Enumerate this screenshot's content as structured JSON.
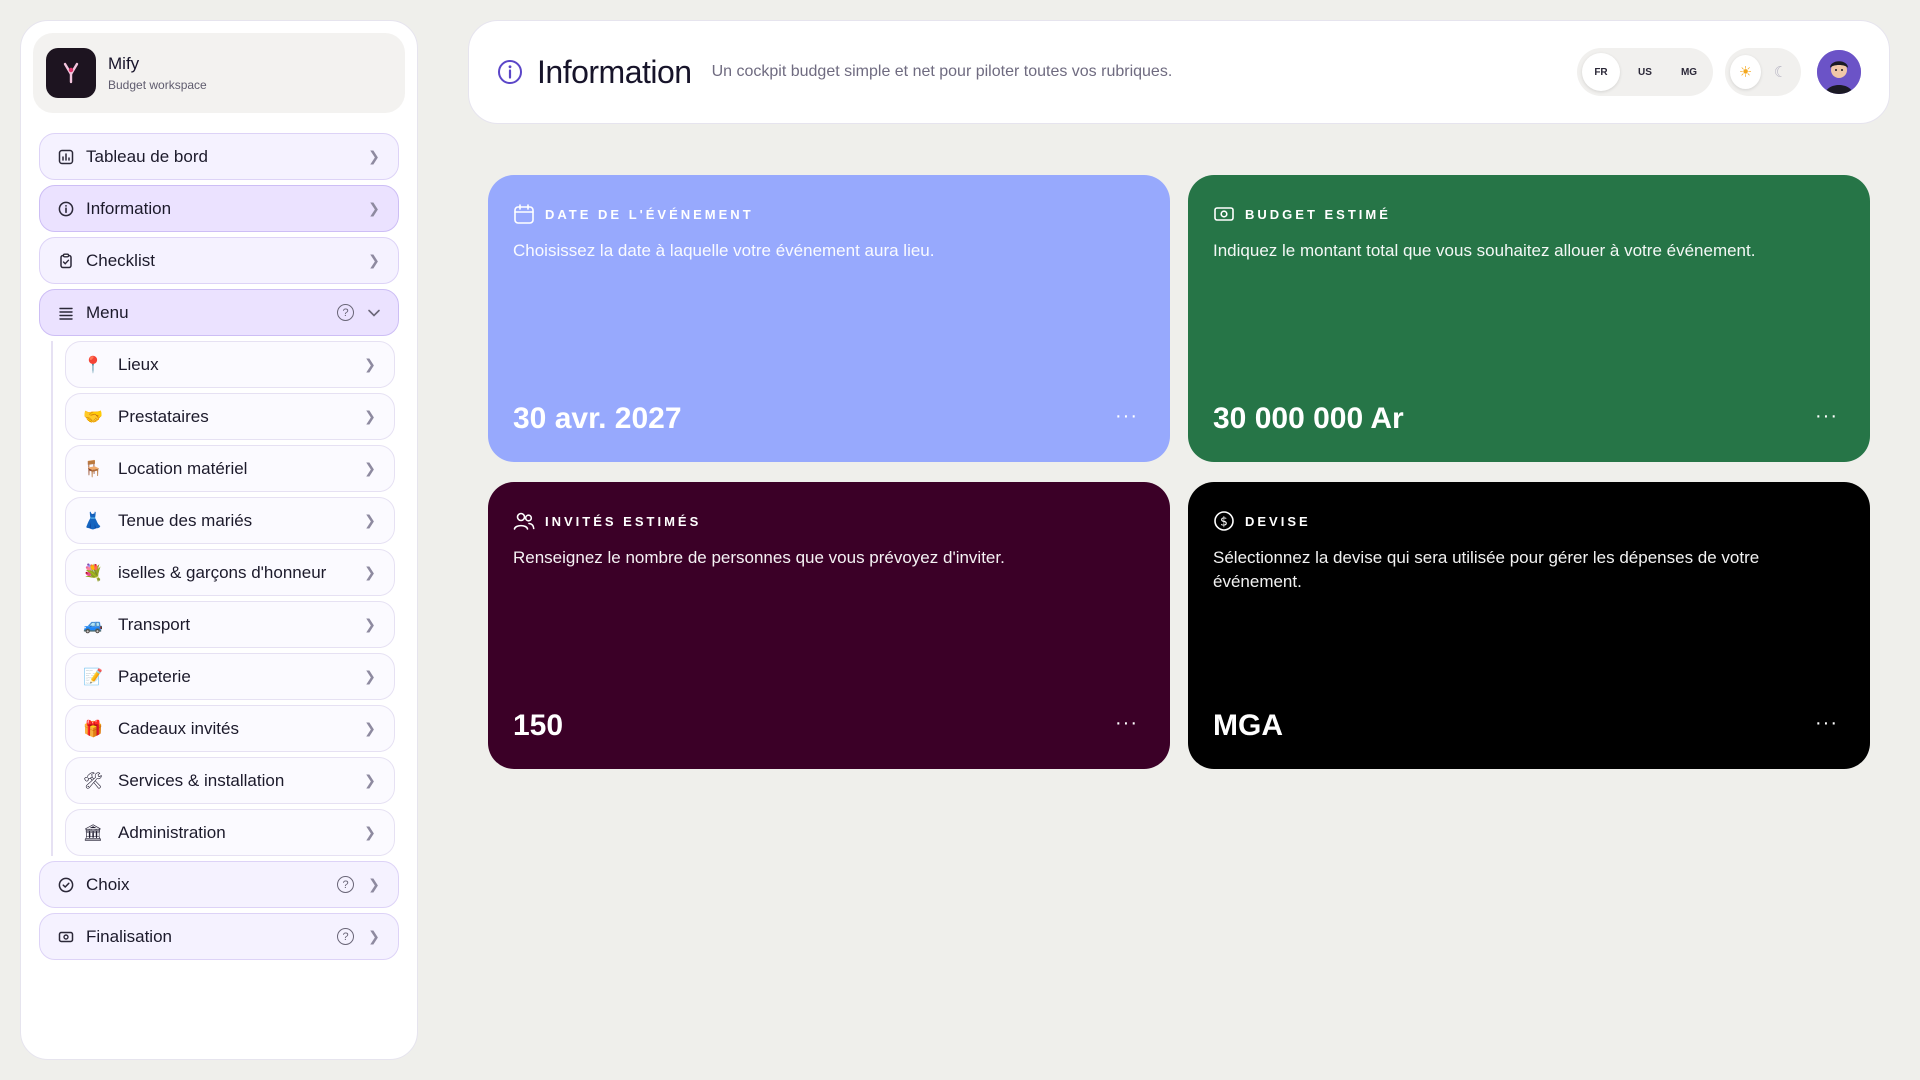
{
  "brand": {
    "name": "Mify",
    "subtitle": "Budget workspace"
  },
  "sidebar": {
    "items": [
      {
        "label": "Tableau de bord",
        "icon": "chart-icon"
      },
      {
        "label": "Information",
        "icon": "info-icon",
        "active": true
      },
      {
        "label": "Checklist",
        "icon": "clipboard-icon"
      },
      {
        "label": "Menu",
        "icon": "menu-icon",
        "expanded": true
      },
      {
        "label": "Choix",
        "icon": "check-circle-icon"
      },
      {
        "label": "Finalisation",
        "icon": "money-icon"
      }
    ],
    "submenu": [
      {
        "label": "Lieux",
        "emoji": "📍"
      },
      {
        "label": "Prestataires",
        "emoji": "🤝"
      },
      {
        "label": "Location matériel",
        "emoji": "🪑"
      },
      {
        "label": "Tenue des mariés",
        "emoji": "👗"
      },
      {
        "label": "iselles & garçons d'honneur",
        "emoji": "💐"
      },
      {
        "label": "Transport",
        "emoji": "🚙"
      },
      {
        "label": "Papeterie",
        "emoji": "📝"
      },
      {
        "label": "Cadeaux invités",
        "emoji": "🎁"
      },
      {
        "label": "Services & installation",
        "emoji": "🛠"
      },
      {
        "label": "Administration",
        "emoji": "🏛"
      }
    ]
  },
  "header": {
    "title": "Information",
    "subtitle": "Un cockpit budget simple et net pour piloter toutes vos rubriques.",
    "languages": [
      "FR",
      "US",
      "MG"
    ],
    "active_language": "FR"
  },
  "cards": [
    {
      "title": "Date de l'événement",
      "description": "Choisissez la date à laquelle votre événement aura lieu.",
      "value": "30 avr. 2027",
      "color": "#97a9fd"
    },
    {
      "title": "Budget estimé",
      "description": "Indiquez le montant total que vous souhaitez allouer à votre événement.",
      "value": "30 000 000 Ar",
      "color": "#267547"
    },
    {
      "title": "Invités estimés",
      "description": "Renseignez le nombre de personnes que vous prévoyez d'inviter.",
      "value": "150",
      "color": "#3b0027"
    },
    {
      "title": "Devise",
      "description": "Sélectionnez la devise qui sera utilisée pour gérer les dépenses de votre événement.",
      "value": "MGA",
      "color": "#000000"
    }
  ],
  "more_label": "···",
  "help_label": "?"
}
